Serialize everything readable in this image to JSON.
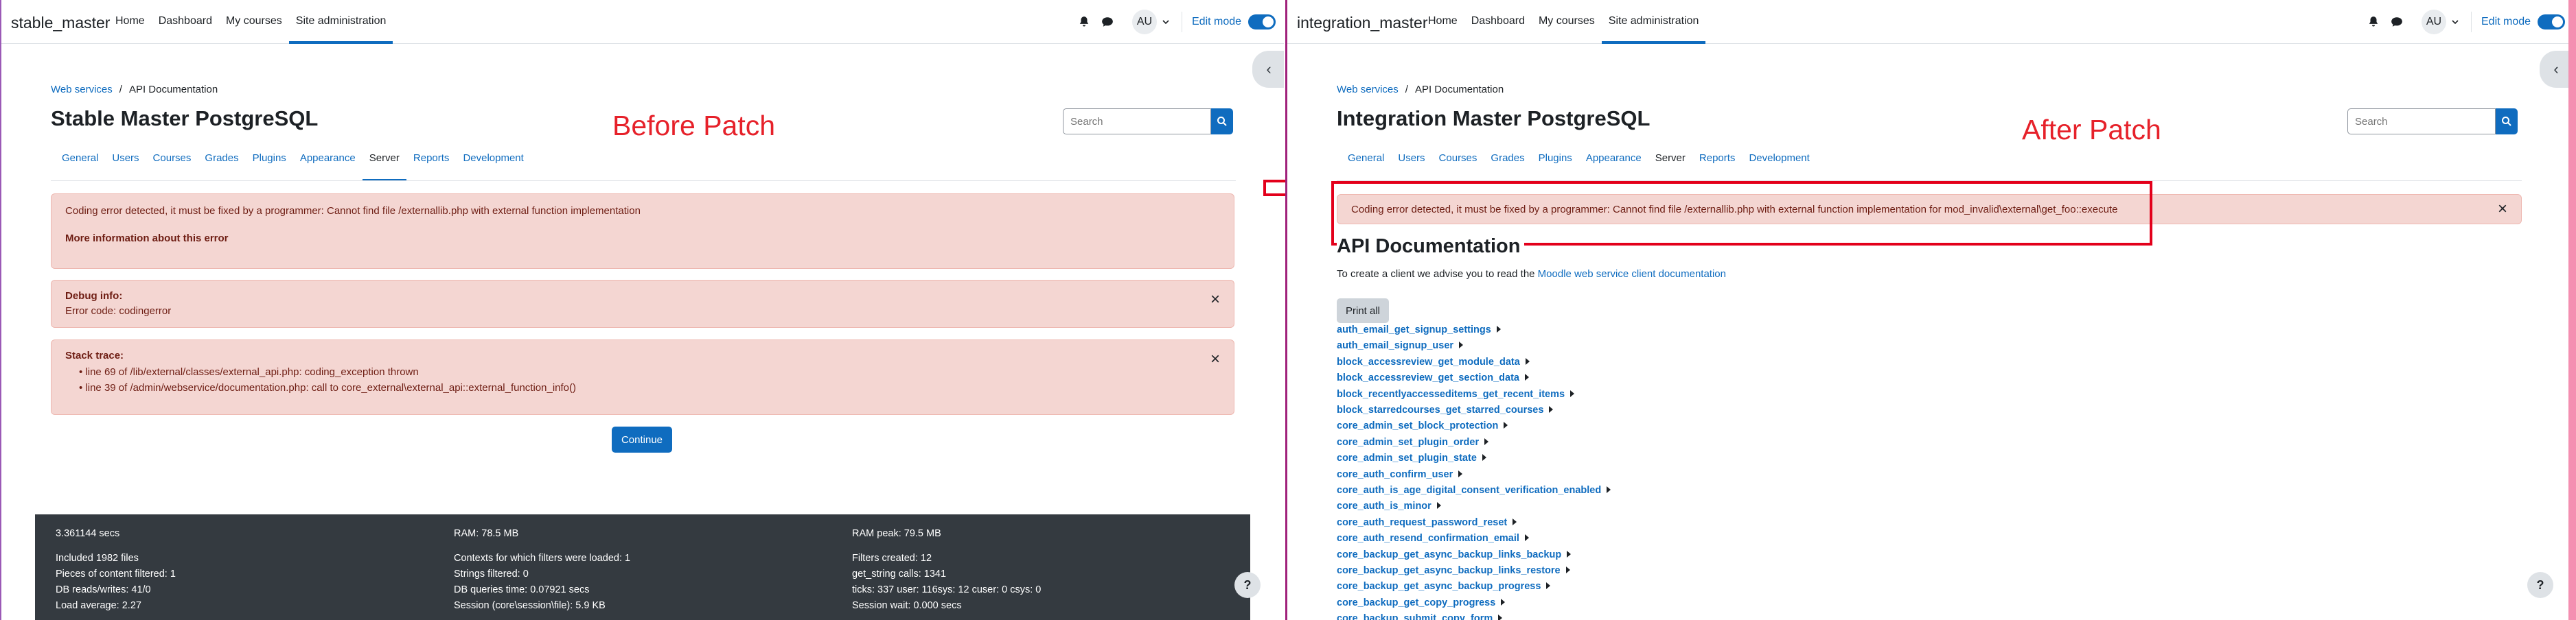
{
  "left": {
    "site_name": "stable_master",
    "nav": [
      "Home",
      "Dashboard",
      "My courses",
      "Site administration"
    ],
    "avatar": "AU",
    "edit_mode": "Edit mode",
    "breadcrumb": [
      "Web services",
      "API Documentation"
    ],
    "page_title": "Stable Master PostgreSQL",
    "search_placeholder": "Search",
    "tabs": [
      "General",
      "Users",
      "Courses",
      "Grades",
      "Plugins",
      "Appearance",
      "Server",
      "Reports",
      "Development"
    ],
    "active_tab": "Server",
    "annotation": "Before Patch",
    "error": {
      "message": "Coding error detected, it must be fixed by a programmer: Cannot find file /externallib.php with external function implementation",
      "more_info": "More information about this error"
    },
    "debug": {
      "title": "Debug info:",
      "code": "Error code: codingerror"
    },
    "stack": {
      "title": "Stack trace:",
      "lines": [
        "line 69 of /lib/external/classes/external_api.php: coding_exception thrown",
        "line 39 of /admin/webservice/documentation.php: call to core_external\\external_api::external_function_info()"
      ]
    },
    "continue": "Continue",
    "footer": {
      "col1": [
        "3.361144 secs",
        "Included 1982 files",
        "Pieces of content filtered: 1",
        "DB reads/writes: 41/0",
        "Load average: 2.27"
      ],
      "col2": [
        "RAM: 78.5 MB",
        "Contexts for which filters were loaded: 1",
        "Strings filtered: 0",
        "DB queries time: 0.07921 secs",
        "Session (core\\session\\file): 5.9 KB"
      ],
      "col3": [
        "RAM peak: 79.5 MB",
        "Filters created: 12",
        "get_string calls: 1341",
        "ticks: 337 user: 116sys: 12 cuser: 0 csys: 0",
        "Session wait: 0.000 secs"
      ]
    },
    "help": "?"
  },
  "right": {
    "site_name": "integration_master",
    "nav": [
      "Home",
      "Dashboard",
      "My courses",
      "Site administration"
    ],
    "avatar": "AU",
    "edit_mode": "Edit mode",
    "breadcrumb": [
      "Web services",
      "API Documentation"
    ],
    "page_title": "Integration Master PostgreSQL",
    "search_placeholder": "Search",
    "tabs": [
      "General",
      "Users",
      "Courses",
      "Grades",
      "Plugins",
      "Appearance",
      "Server",
      "Reports",
      "Development"
    ],
    "annotation": "After Patch",
    "error": "Coding error detected, it must be fixed by a programmer: Cannot find file /externallib.php with external function implementation for mod_invalid\\external\\get_foo::execute",
    "api_heading": "API Documentation",
    "intro_prefix": "To create a client we advise you to read the ",
    "intro_link": "Moodle web service client documentation",
    "print_all": "Print all",
    "functions": [
      "auth_email_get_signup_settings",
      "auth_email_signup_user",
      "block_accessreview_get_module_data",
      "block_accessreview_get_section_data",
      "block_recentlyaccesseditems_get_recent_items",
      "block_starredcourses_get_starred_courses",
      "core_admin_set_block_protection",
      "core_admin_set_plugin_order",
      "core_admin_set_plugin_state",
      "core_auth_confirm_user",
      "core_auth_is_age_digital_consent_verification_enabled",
      "core_auth_is_minor",
      "core_auth_request_password_reset",
      "core_auth_resend_confirmation_email",
      "core_backup_get_async_backup_links_backup",
      "core_backup_get_async_backup_links_restore",
      "core_backup_get_async_backup_progress",
      "core_backup_get_copy_progress",
      "core_backup_submit_copy_form"
    ],
    "help": "?"
  },
  "icon_names": [
    "bell-icon",
    "chat-icon",
    "search-icon",
    "chevron-left-icon",
    "close-icon",
    "arrow-right-icon"
  ],
  "colors": {
    "accent": "#0f6cbf",
    "alert_bg": "#f4d6d2",
    "alert_text": "#6e1d13",
    "annotation": "#e6212a",
    "footer_bg": "#343a40"
  }
}
